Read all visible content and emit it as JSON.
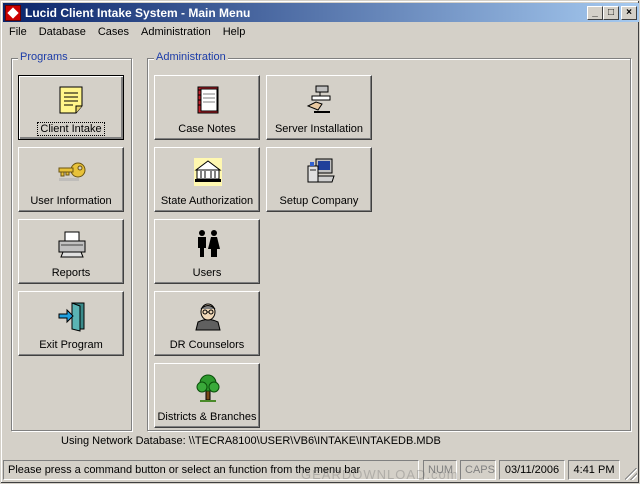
{
  "window": {
    "title": "Lucid Client Intake System - Main Menu",
    "controls": {
      "minimize": "_",
      "maximize": "□",
      "close": "×"
    }
  },
  "menu": [
    "File",
    "Database",
    "Cases",
    "Administration",
    "Help"
  ],
  "programs": {
    "label": "Programs",
    "buttons": [
      {
        "label": "Client Intake",
        "icon": "notepad-icon"
      },
      {
        "label": "User Information",
        "icon": "key-icon"
      },
      {
        "label": "Reports",
        "icon": "printer-icon"
      },
      {
        "label": "Exit Program",
        "icon": "exit-door-icon"
      }
    ]
  },
  "administration": {
    "label": "Administration",
    "buttons": [
      {
        "label": "Case Notes",
        "icon": "notebook-icon"
      },
      {
        "label": "Server Installation",
        "icon": "server-install-icon"
      },
      {
        "label": "State Authorization",
        "icon": "state-building-icon"
      },
      {
        "label": "Setup Company",
        "icon": "computer-setup-icon"
      },
      {
        "label": "Users",
        "icon": "users-icon"
      },
      {
        "label": "DR Counselors",
        "icon": "counselor-icon"
      },
      {
        "label": "Districts & Branches",
        "icon": "tree-icon"
      }
    ]
  },
  "network": {
    "text": "Using Network Database: \\\\TECRA8100\\USER\\VB6\\INTAKE\\INTAKEDB.MDB"
  },
  "status": {
    "message": "Please press a command button or select an function from the menu bar",
    "num": "NUM",
    "caps": "CAPS",
    "date": "03/11/2006",
    "time": "4:41 PM"
  },
  "watermark": "GEARDOWNLOAD.com"
}
